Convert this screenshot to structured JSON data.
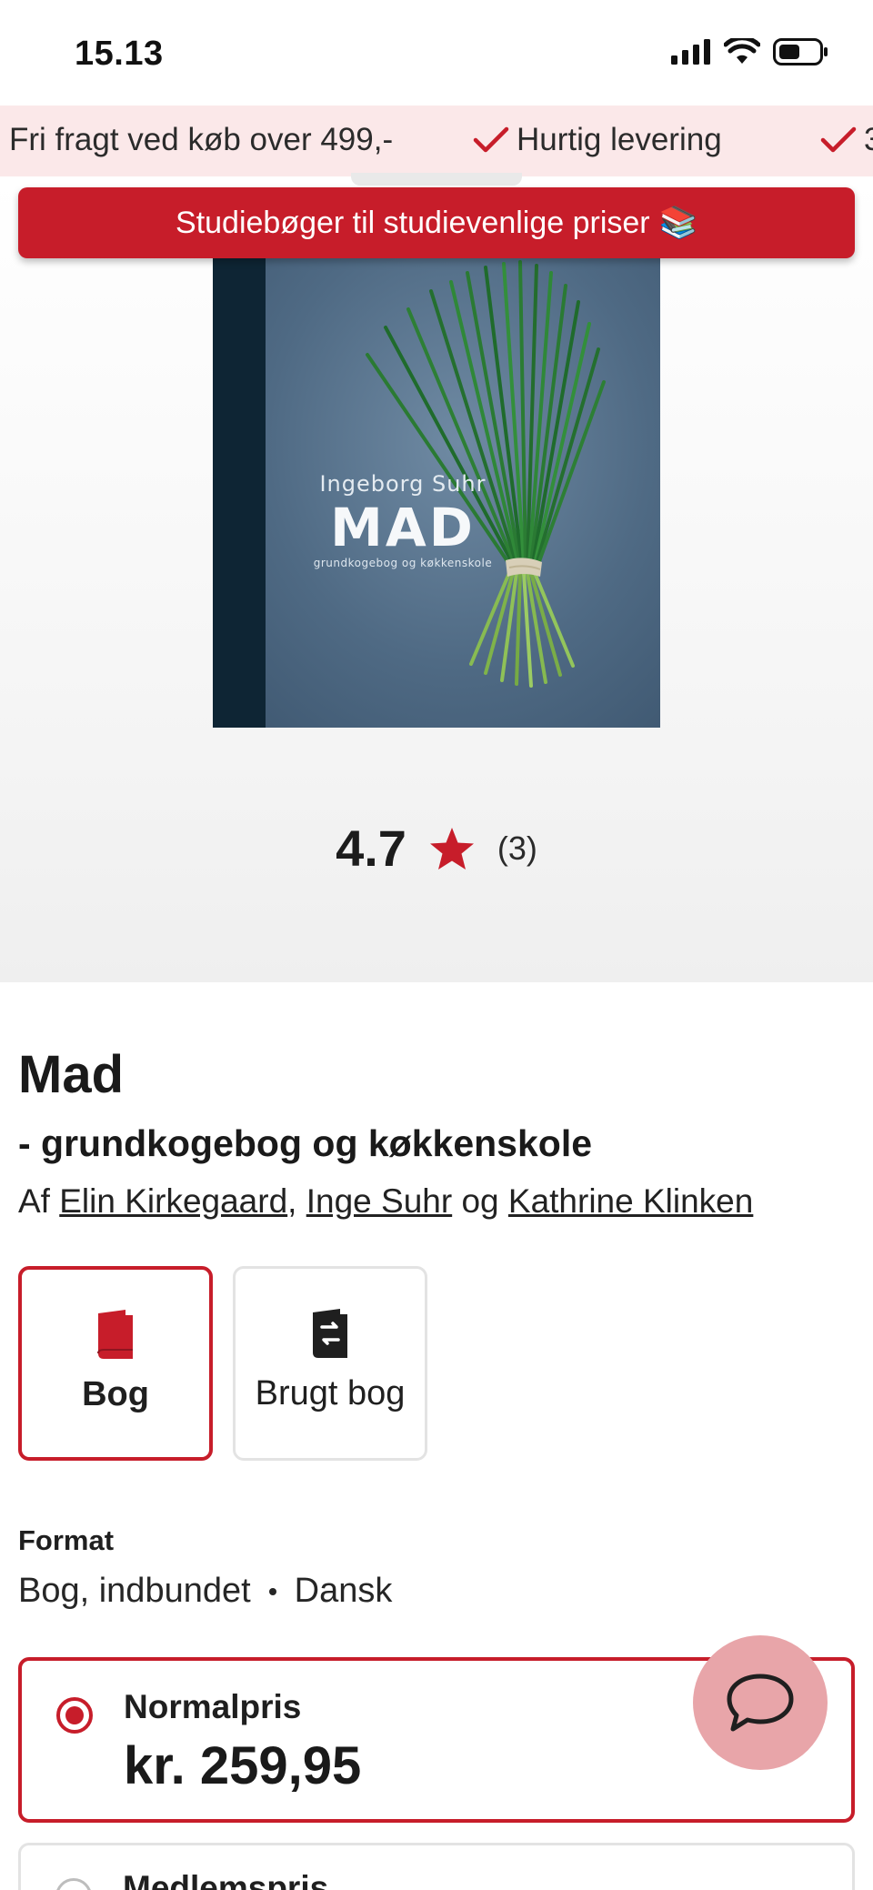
{
  "status_bar": {
    "time": "15.13"
  },
  "usp": [
    {
      "text": "Fri fragt ved køb over 499,-"
    },
    {
      "text": "Hurtig levering"
    },
    {
      "text": "3"
    }
  ],
  "banner": {
    "text": "Studiebøger til studievenlige priser",
    "emoji": "📚"
  },
  "cover": {
    "author": "Ingeborg Suhr",
    "title": "MAD",
    "subtitle": "grundkogebog og køkkenskole"
  },
  "rating": {
    "value": "4.7",
    "count": "(3)"
  },
  "product": {
    "title": "Mad",
    "subtitle": "- grundkogebog og køkkenskole",
    "by_prefix": "Af",
    "authors": [
      "Elin Kirkegaard",
      "Inge Suhr",
      "Kathrine Klinken"
    ],
    "author_sep": ",",
    "author_and": "og"
  },
  "format_options": [
    {
      "label": "Bog",
      "icon": "book-icon",
      "selected": true
    },
    {
      "label": "Brugt bog",
      "icon": "used-book-icon",
      "selected": false
    }
  ],
  "format": {
    "heading": "Format",
    "binding": "Bog, indbundet",
    "language": "Dansk"
  },
  "prices": [
    {
      "label": "Normalpris",
      "value": "kr. 259,95",
      "selected": true
    },
    {
      "label": "Medlemspris",
      "selected": false
    }
  ],
  "colors": {
    "accent": "#c71d2a",
    "usp_bg": "#fbe8e9",
    "chat_bg": "#e8a5a9"
  }
}
